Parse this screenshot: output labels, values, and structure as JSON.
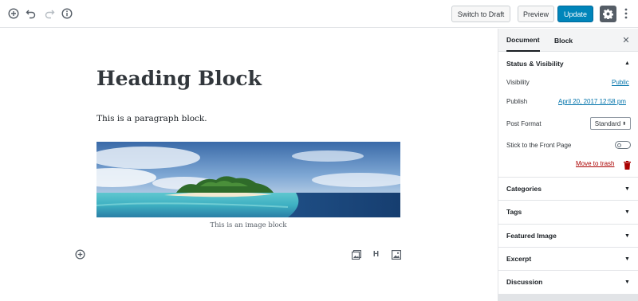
{
  "toolbar": {
    "inserter_icon": "plus-circle-icon",
    "undo_icon": "undo-icon",
    "redo_icon": "redo-icon",
    "info_icon": "info-icon",
    "switch_to_draft_label": "Switch to Draft",
    "preview_label": "Preview",
    "update_label": "Update",
    "settings_icon": "gear-icon",
    "more_icon": "vertical-ellipsis-icon"
  },
  "editor": {
    "heading": "Heading Block",
    "paragraph": "This is a paragraph block.",
    "image_caption": "This is an image block",
    "quick_inserter": [
      "gallery-icon",
      "heading-icon",
      "image-icon"
    ],
    "heading_shortcut_label": "H"
  },
  "sidebar": {
    "tabs": [
      {
        "label": "Document",
        "active": true
      },
      {
        "label": "Block",
        "active": false
      }
    ],
    "close_icon": "close-icon",
    "status_panel": {
      "title": "Status & Visibility",
      "expanded": true,
      "visibility_label": "Visibility",
      "visibility_value": "Public",
      "publish_label": "Publish",
      "publish_value": "April 20, 2017 12:58 pm",
      "post_format_label": "Post Format",
      "post_format_value": "Standard",
      "sticky_label": "Stick to the Front Page",
      "sticky_on": false,
      "trash_label": "Move to trash"
    },
    "panels": [
      {
        "title": "Categories",
        "expanded": false
      },
      {
        "title": "Tags",
        "expanded": false
      },
      {
        "title": "Featured Image",
        "expanded": false
      },
      {
        "title": "Excerpt",
        "expanded": false
      },
      {
        "title": "Discussion",
        "expanded": false
      }
    ]
  },
  "colors": {
    "accent": "#0085ba",
    "link": "#0073aa",
    "danger": "#a00",
    "settings_bg": "#555d66"
  }
}
